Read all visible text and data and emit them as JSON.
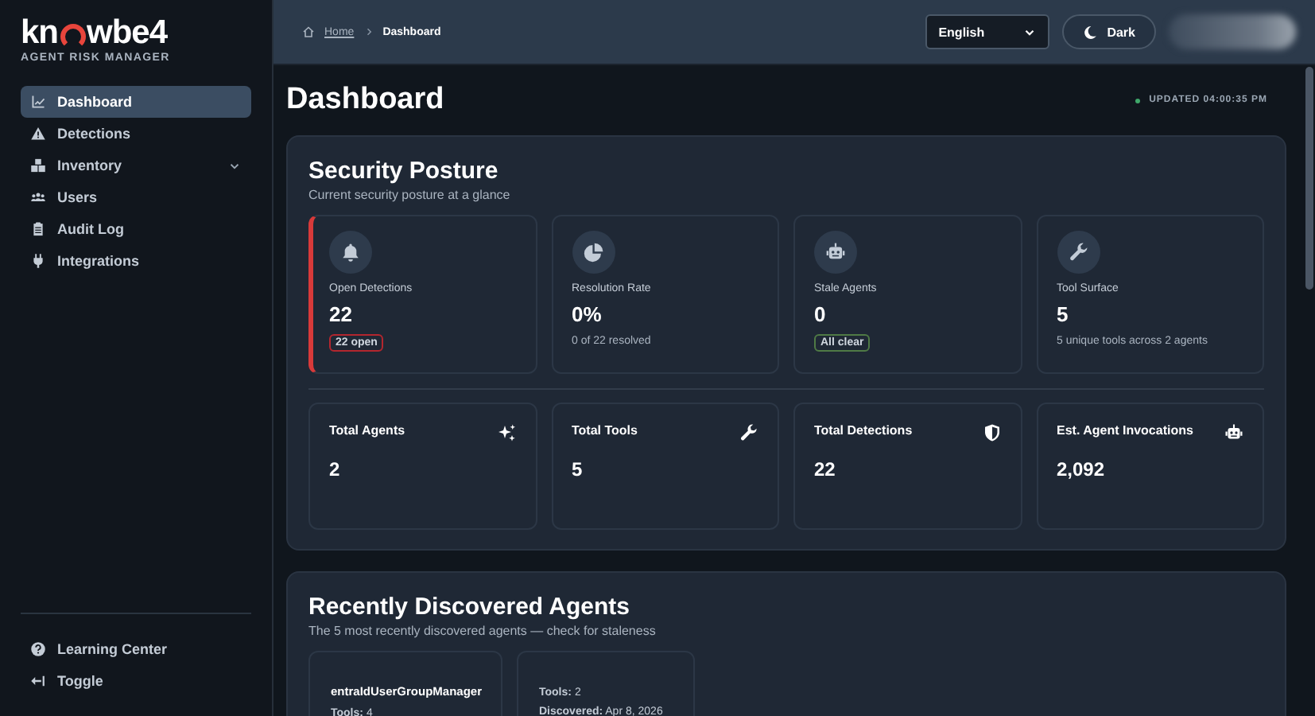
{
  "brand": {
    "name_start": "kn",
    "name_end": "wbe4",
    "tagline": "AGENT RISK MANAGER"
  },
  "sidebar": {
    "items": [
      {
        "label": "Dashboard",
        "selected": true
      },
      {
        "label": "Detections",
        "selected": false
      },
      {
        "label": "Inventory",
        "selected": false,
        "expanded": false
      },
      {
        "label": "Users",
        "selected": false
      },
      {
        "label": "Audit Log",
        "selected": false
      },
      {
        "label": "Integrations",
        "selected": false
      }
    ],
    "footer": [
      {
        "label": "Learning Center"
      },
      {
        "label": "Toggle"
      }
    ]
  },
  "breadcrumb": [
    {
      "label": "Home",
      "link": true
    },
    {
      "label": "Dashboard",
      "link": false
    }
  ],
  "language": {
    "value": "English"
  },
  "theme_button": {
    "label": "Dark"
  },
  "page_title": "Dashboard",
  "updated": "UPDATED 04:00:35 PM",
  "security_posture": {
    "title": "Security Posture",
    "subtitle": "Current security posture at a glance",
    "cards": [
      {
        "label": "Open Detections",
        "value": "22",
        "alert": true,
        "badge": {
          "text": "22 open",
          "color": "#b3262e"
        }
      },
      {
        "label": "Resolution Rate",
        "value": "0%",
        "alert": false,
        "note": "0 of 22 resolved"
      },
      {
        "label": "Stale Agents",
        "value": "0",
        "alert": false,
        "badge": {
          "text": "All clear",
          "color": "#4f7a45"
        }
      },
      {
        "label": "Tool Surface",
        "value": "5",
        "alert": false,
        "note": "5 unique tools across 2 agents"
      }
    ],
    "totals": [
      {
        "label": "Total Agents",
        "value": "2"
      },
      {
        "label": "Total Tools",
        "value": "5"
      },
      {
        "label": "Total Detections",
        "value": "22"
      },
      {
        "label": "Est. Agent Invocations",
        "value": "2,092"
      }
    ]
  },
  "recent_agents": {
    "title": "Recently Discovered Agents",
    "subtitle": "The 5 most recently discovered agents — check for staleness",
    "agents": [
      {
        "name": "entraIdUserGroupManager",
        "details": [
          {
            "label": "Tools:",
            "value": "4"
          }
        ]
      },
      {
        "details": [
          {
            "label": "Tools:",
            "value": "2"
          },
          {
            "label": "Discovered:",
            "value": "Apr 8, 2026"
          }
        ]
      }
    ]
  }
}
